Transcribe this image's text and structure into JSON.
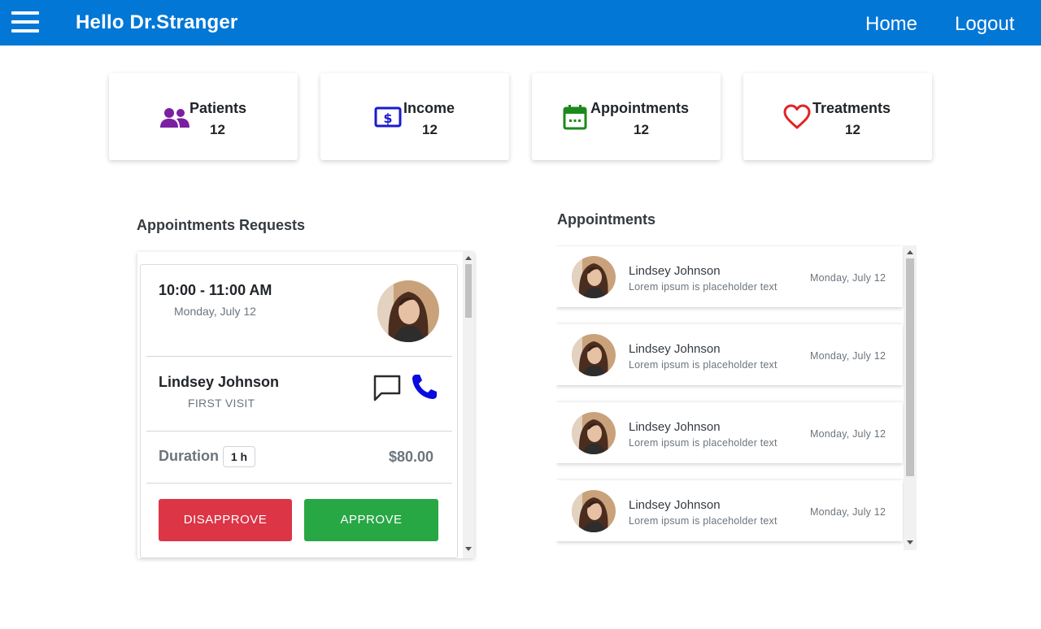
{
  "header": {
    "greeting": "Hello Dr.Stranger",
    "nav": {
      "home": "Home",
      "logout": "Logout"
    },
    "bar_color": "#0277d6"
  },
  "stats": [
    {
      "label": "Patients",
      "count": "12",
      "icon": "people-icon",
      "color": "#7b1fa2"
    },
    {
      "label": "Income",
      "count": "12",
      "icon": "dollar-icon",
      "color": "#1a1acf"
    },
    {
      "label": "Appointments",
      "count": "12",
      "icon": "calendar-icon",
      "color": "#1b8a1b"
    },
    {
      "label": "Treatments",
      "count": "12",
      "icon": "heart-icon",
      "color": "#e02424"
    }
  ],
  "requests": {
    "title": "Appointments Requests",
    "card": {
      "time": "10:00 - 11:00 AM",
      "date": "Monday, July 12",
      "name": "Lindsey Johnson",
      "visit": "FIRST VISIT",
      "duration_label": "Duration",
      "duration_value": "1 h",
      "price": "$80.00",
      "disapprove": "DISAPPROVE",
      "approve": "APPROVE"
    }
  },
  "appointments": {
    "title": "Appointments",
    "items": [
      {
        "name": "Lindsey Johnson",
        "text": "Lorem ipsum is placeholder text",
        "date": "Monday, July 12"
      },
      {
        "name": "Lindsey Johnson",
        "text": "Lorem ipsum is placeholder text",
        "date": "Monday, July 12"
      },
      {
        "name": "Lindsey Johnson",
        "text": "Lorem ipsum is placeholder text",
        "date": "Monday, July 12"
      },
      {
        "name": "Lindsey Johnson",
        "text": "Lorem ipsum is placeholder text",
        "date": "Monday, July 12"
      }
    ]
  }
}
